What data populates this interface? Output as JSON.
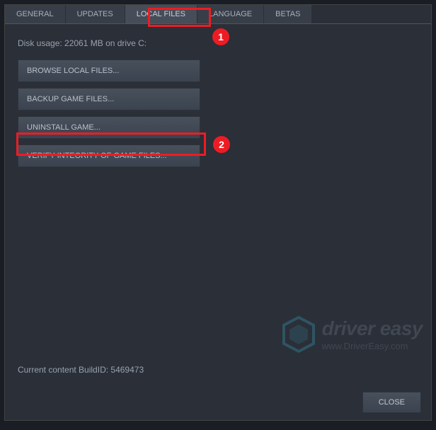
{
  "tabs": {
    "general": "GENERAL",
    "updates": "UPDATES",
    "local_files": "LOCAL FILES",
    "language": "LANGUAGE",
    "betas": "BETAS"
  },
  "content": {
    "disk_usage": "Disk usage: 22061 MB on drive C:",
    "buttons": {
      "browse": "BROWSE LOCAL FILES...",
      "backup": "BACKUP GAME FILES...",
      "uninstall": "UNINSTALL GAME...",
      "verify": "VERIFY INTEGRITY OF GAME FILES..."
    },
    "build_id": "Current content BuildID: 5469473"
  },
  "footer": {
    "close": "CLOSE"
  },
  "annotations": {
    "badge1": "1",
    "badge2": "2"
  },
  "watermark": {
    "brand": "driver easy",
    "url": "www.DriverEasy.com"
  }
}
